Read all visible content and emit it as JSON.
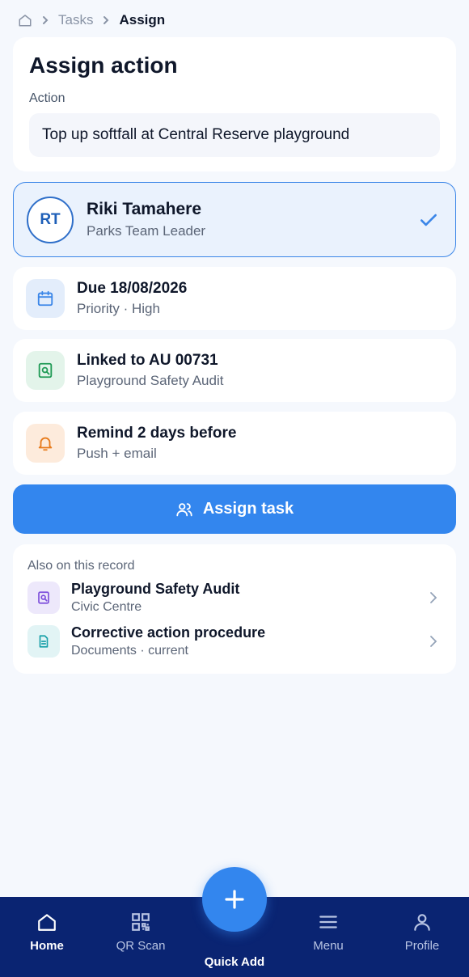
{
  "breadcrumb": {
    "home_icon": "home-icon",
    "items": [
      "Tasks",
      "Assign"
    ]
  },
  "action_card": {
    "title": "Assign action",
    "field_label": "Action",
    "field_value": "Top up softfall at Central Reserve playground"
  },
  "assignee": {
    "initials": "RT",
    "name": "Riki Tamahere",
    "role": "Parks Team Leader",
    "selected": true
  },
  "details": {
    "due": {
      "title": "Due 18/08/2026",
      "subtitle": "Priority · High",
      "icon": "calendar-icon"
    },
    "linked": {
      "title": "Linked to AU 00731",
      "subtitle": "Playground Safety Audit",
      "icon": "audit-search-icon"
    },
    "reminder": {
      "title": "Remind 2 days before",
      "subtitle": "Push + email",
      "icon": "bell-icon"
    }
  },
  "assign_button": {
    "label": "Assign task",
    "icon": "users-icon"
  },
  "related": {
    "heading": "Also on this record",
    "items": [
      {
        "title": "Playground Safety Audit",
        "subtitle": "Civic Centre",
        "icon": "audit-search-icon"
      },
      {
        "title": "Corrective action procedure",
        "subtitle": "Documents · current",
        "icon": "document-icon"
      }
    ]
  },
  "bottom_nav": {
    "items": [
      {
        "label": "Home",
        "icon": "home-icon",
        "active": true
      },
      {
        "label": "QR Scan",
        "icon": "qr-icon",
        "active": false
      },
      {
        "label": "Menu",
        "icon": "menu-icon",
        "active": false
      },
      {
        "label": "Profile",
        "icon": "user-icon",
        "active": false
      }
    ],
    "fab_label": "Quick Add"
  },
  "colors": {
    "accent": "#3386ee",
    "nav_background": "#0a2472",
    "selected_border": "#3b86e8"
  }
}
